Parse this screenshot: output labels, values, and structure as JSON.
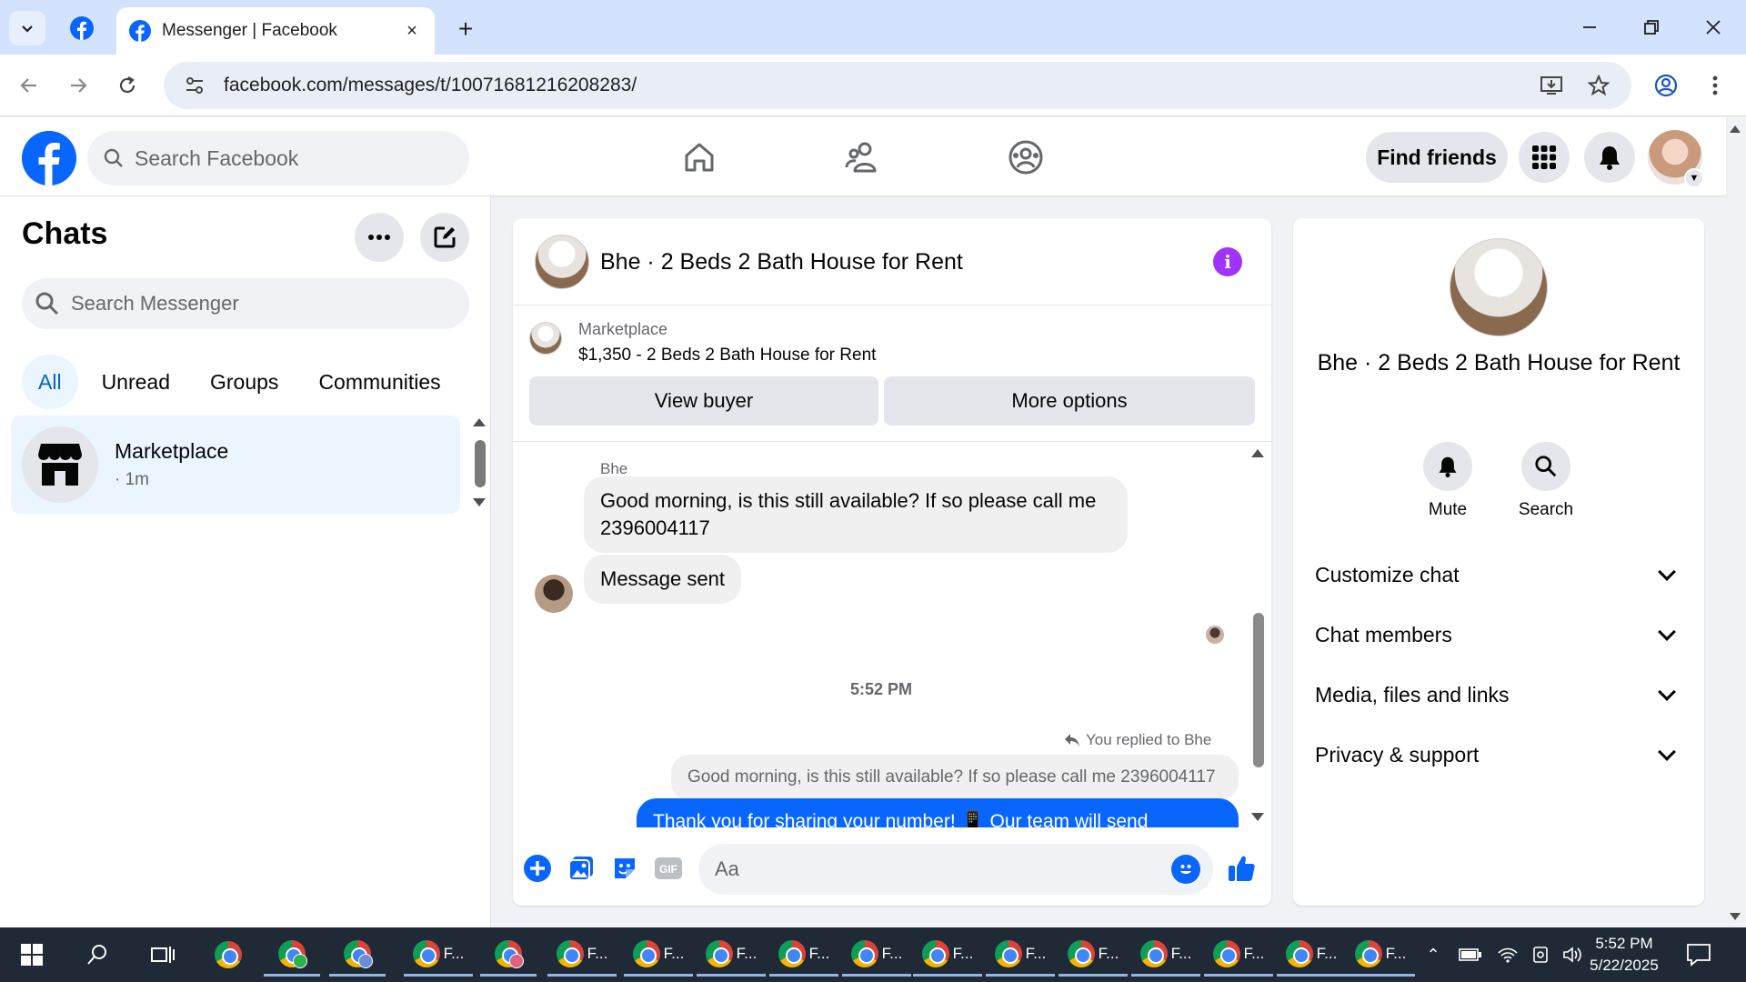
{
  "browser": {
    "tab_title": "Messenger | Facebook",
    "url": "facebook.com/messages/t/10071681216208283/",
    "new_tab_label": "+",
    "close_tab_label": "×"
  },
  "fb": {
    "search_placeholder": "Search Facebook",
    "find_friends": "Find friends",
    "brand_color": "#0866ff"
  },
  "chats": {
    "title": "Chats",
    "search_placeholder": "Search Messenger",
    "filters": [
      "All",
      "Unread",
      "Groups",
      "Communities"
    ],
    "active_filter": "All",
    "items": [
      {
        "name": "Marketplace",
        "meta": "· 1m"
      }
    ]
  },
  "conversation": {
    "title": "Bhe · 2 Beds 2 Bath House for Rent",
    "marketplace_label": "Marketplace",
    "listing": "$1,350 - 2 Beds 2 Bath House for Rent",
    "view_buyer": "View buyer",
    "more_options": "More options",
    "sender_name": "Bhe",
    "messages": [
      {
        "text": "Good morning, is this still available? If so please call me 2396004117",
        "direction": "in"
      },
      {
        "text": "Message sent",
        "direction": "in"
      }
    ],
    "timestamp": "5:52 PM",
    "replied_to": "You replied to Bhe",
    "quoted_text": "Good morning, is this still available? If so please call me 2396004117",
    "outgoing_text": "Thank you for sharing your number! 📱 Our team will send",
    "composer_placeholder": "Aa"
  },
  "info_panel": {
    "title": "Bhe · 2 Beds 2 Bath House for Rent",
    "actions": [
      "Mute",
      "Search"
    ],
    "sections": [
      "Customize chat",
      "Chat members",
      "Media, files and links",
      "Privacy & support"
    ]
  },
  "taskbar": {
    "app_label": "F...",
    "time": "5:52 PM",
    "date": "5/22/2025"
  }
}
